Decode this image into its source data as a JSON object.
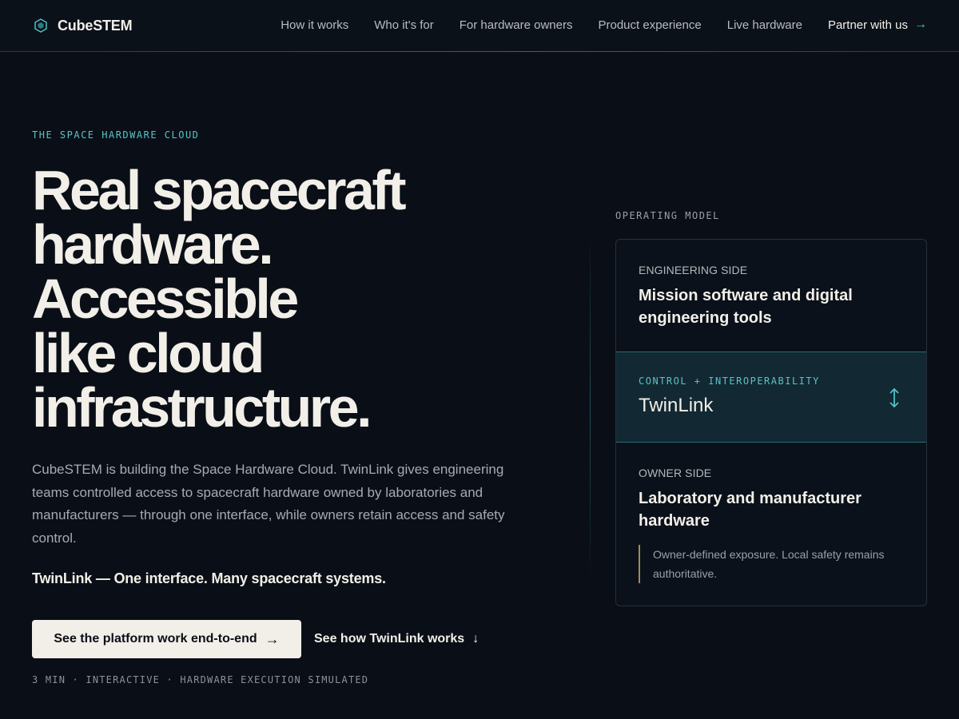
{
  "nav": {
    "brand": "CubeSTEM",
    "links": [
      "How it works",
      "Who it's for",
      "For hardware owners",
      "Product experience",
      "Live hardware"
    ],
    "cta": "Partner with us",
    "cta_arrow": "→"
  },
  "hero": {
    "eyebrow": "THE SPACE HARDWARE CLOUD",
    "headline_lines": [
      "Real spacecraft",
      "hardware.",
      "Accessible",
      "like cloud",
      "infrastructure."
    ],
    "lede": "CubeSTEM is building the Space Hardware Cloud. TwinLink gives engineering teams controlled access to spacecraft hardware owned by laboratories and manufacturers — through one interface, while owners retain access and safety control.",
    "tagline": "TwinLink — One interface. Many spacecraft systems.",
    "primary_button": "See the platform work end-to-end",
    "primary_arrow": "→",
    "secondary_button": "See how TwinLink works",
    "secondary_arrow": "↓",
    "meta": "3 MIN · INTERACTIVE · HARDWARE EXECUTION SIMULATED"
  },
  "operating_model": {
    "label": "OPERATING MODEL",
    "engineering": {
      "kicker": "ENGINEERING SIDE",
      "title": "Mission software and digital engineering tools"
    },
    "twinlink": {
      "kicker": "CONTROL + INTEROPERABILITY",
      "title": "TwinLink",
      "icon": "bidirectional-arrow-icon"
    },
    "owner": {
      "kicker": "OWNER SIDE",
      "title": "Laboratory and manufacturer hardware",
      "note": "Owner-defined exposure. Local safety remains authoritative."
    }
  },
  "colors": {
    "background": "#0a0f17",
    "text": "#f2efe8",
    "accent": "#59c3c6",
    "note_rule": "#a38a5a"
  }
}
